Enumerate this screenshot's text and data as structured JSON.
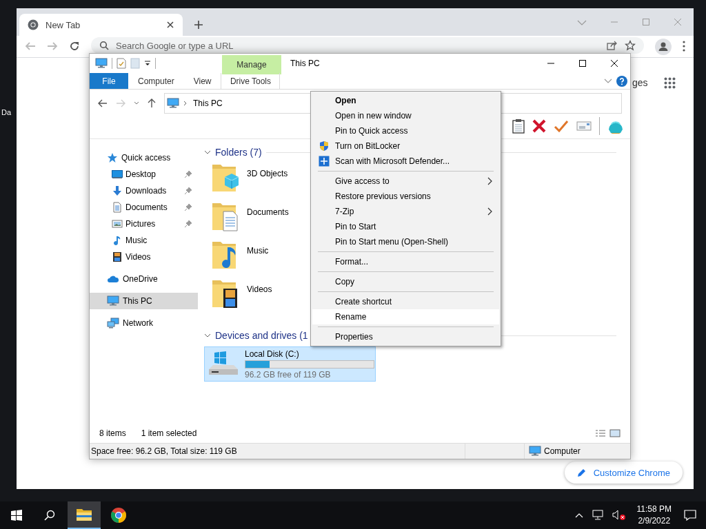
{
  "desktop": {
    "icon_label": "Da"
  },
  "chrome": {
    "tab": {
      "title": "New Tab",
      "selected": true
    },
    "omnibox": {
      "placeholder": "Search Google or type a URL"
    },
    "shortcut_label": "ges",
    "customize_button": "Customize Chrome"
  },
  "explorer": {
    "title": "This PC",
    "contextual_group": "Manage",
    "ribbon_tabs": [
      {
        "label": "File",
        "kind": "file"
      },
      {
        "label": "Computer",
        "kind": "tab"
      },
      {
        "label": "View",
        "kind": "tab"
      },
      {
        "label": "Drive Tools",
        "kind": "contextual"
      }
    ],
    "address": {
      "location": "This PC"
    },
    "nav": [
      {
        "label": "Quick access",
        "kind": "star",
        "selected": false,
        "children": [
          {
            "label": "Desktop",
            "kind": "desktop",
            "pinned": true,
            "selected": false
          },
          {
            "label": "Downloads",
            "kind": "download",
            "pinned": true,
            "selected": false
          },
          {
            "label": "Documents",
            "kind": "document",
            "pinned": true,
            "selected": false
          },
          {
            "label": "Pictures",
            "kind": "pictures",
            "pinned": true,
            "selected": false
          },
          {
            "label": "Music",
            "kind": "music",
            "pinned": false,
            "selected": false
          },
          {
            "label": "Videos",
            "kind": "videos",
            "pinned": false,
            "selected": false
          }
        ]
      },
      {
        "label": "OneDrive",
        "kind": "cloud",
        "selected": false
      },
      {
        "label": "This PC",
        "kind": "pc",
        "selected": true
      },
      {
        "label": "Network",
        "kind": "network",
        "selected": false
      }
    ],
    "groups": [
      {
        "title": "Folders (7)",
        "expanded": true,
        "items": [
          {
            "name": "3D Objects",
            "kind": "cube"
          },
          {
            "name": "Documents",
            "kind": "document"
          },
          {
            "name": "Music",
            "kind": "music"
          },
          {
            "name": "Videos",
            "kind": "videos"
          }
        ]
      },
      {
        "title": "Devices and drives (1",
        "expanded": true,
        "drives": [
          {
            "name": "Local Disk (C:)",
            "level": 0.19,
            "free": "96.2 GB free of 119 GB",
            "selected": true
          }
        ]
      }
    ],
    "item_count": "8 items",
    "selection_count": "1 item selected",
    "status_bar": {
      "space": "Space free: 96.2 GB, Total size: 119 GB",
      "zone": "Computer"
    }
  },
  "context_menu": {
    "sections": [
      [
        {
          "label": "Open",
          "bold": true,
          "submenu": false,
          "selected": false
        },
        {
          "label": "Open in new window",
          "bold": false,
          "submenu": false,
          "selected": false
        },
        {
          "label": "Pin to Quick access",
          "bold": false,
          "submenu": false,
          "selected": false
        },
        {
          "label": "Turn on BitLocker",
          "kind": "shield",
          "bold": false,
          "submenu": false,
          "selected": false
        },
        {
          "label": "Scan with Microsoft Defender...",
          "kind": "defender",
          "bold": false,
          "submenu": false,
          "selected": false
        }
      ],
      [
        {
          "label": "Give access to",
          "bold": false,
          "submenu": true,
          "selected": false
        },
        {
          "label": "Restore previous versions",
          "bold": false,
          "submenu": false,
          "selected": false
        },
        {
          "label": "7-Zip",
          "bold": false,
          "submenu": true,
          "selected": false
        },
        {
          "label": "Pin to Start",
          "bold": false,
          "submenu": false,
          "selected": false
        },
        {
          "label": "Pin to Start menu (Open-Shell)",
          "bold": false,
          "submenu": false,
          "selected": false
        }
      ],
      [
        {
          "label": "Format...",
          "bold": false,
          "submenu": false,
          "selected": false
        }
      ],
      [
        {
          "label": "Copy",
          "bold": false,
          "submenu": false,
          "selected": false
        }
      ],
      [
        {
          "label": "Create shortcut",
          "bold": false,
          "submenu": false,
          "selected": false
        },
        {
          "label": "Rename",
          "bold": false,
          "submenu": false,
          "selected": true
        }
      ],
      [
        {
          "label": "Properties",
          "bold": false,
          "submenu": false,
          "selected": false
        }
      ]
    ]
  },
  "taskbar": {
    "apps": [
      {
        "kind": "explorer",
        "selected": true
      },
      {
        "kind": "chrome",
        "selected": false
      }
    ],
    "time": "11:58 PM",
    "date": "2/9/2022",
    "volume_muted": true
  }
}
